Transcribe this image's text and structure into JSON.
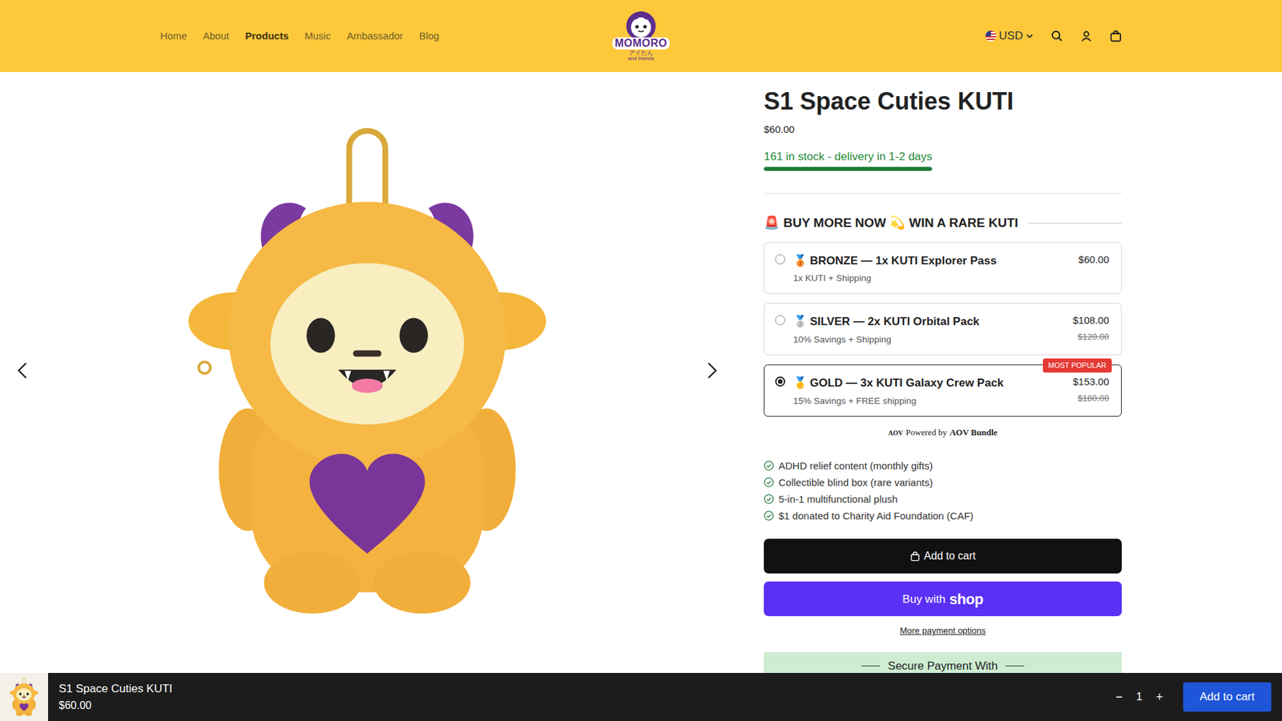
{
  "header": {
    "nav": [
      {
        "label": "Home",
        "selected": false
      },
      {
        "label": "About",
        "selected": false
      },
      {
        "label": "Products",
        "selected": true
      },
      {
        "label": "Music",
        "selected": false
      },
      {
        "label": "Ambassador",
        "selected": false
      },
      {
        "label": "Blog",
        "selected": false
      }
    ],
    "logo": {
      "name": "MOMORO",
      "sub": "アイたん",
      "tagline": "and friends"
    },
    "currency": "USD"
  },
  "product": {
    "title": "S1 Space Cuties KUTI",
    "price": "$60.00",
    "stock": {
      "text": "161 in stock - delivery in 1-2 days",
      "level": 1
    }
  },
  "bundle": {
    "heading": "🚨 BUY MORE NOW 💫 WIN A RARE KUTI",
    "options": [
      {
        "medal": "🥉",
        "title": "BRONZE — 1x KUTI Explorer Pass",
        "subtitle": "1x KUTI + Shipping",
        "price": "$60.00",
        "selected": false
      },
      {
        "medal": "🥈",
        "title": "SILVER — 2x KUTI Orbital Pack",
        "subtitle": "10% Savings + Shipping",
        "price": "$108.00",
        "compare": "$120.00",
        "selected": false
      },
      {
        "medal": "🥇",
        "title": "GOLD — 3x KUTI Galaxy Crew Pack",
        "subtitle": "15% Savings + FREE shipping",
        "price": "$153.00",
        "compare": "$180.00",
        "badge": "MOST POPULAR",
        "selected": true
      }
    ],
    "powered": {
      "mark": "AOV",
      "text": "Powered by",
      "brand": "AOV Bundle"
    }
  },
  "features": [
    "ADHD relief content (monthly gifts)",
    "Collectible blind box (rare variants)",
    "5-in-1 multifunctional plush",
    "$1 donated to Charity Aid Foundation (CAF)"
  ],
  "buttons": {
    "add_to_cart": "Add to cart",
    "buy_with": "Buy with",
    "shop": "shop",
    "more_payment": "More payment options",
    "secure": "Secure Payment With"
  },
  "sticky_bar": {
    "title": "S1 Space Cuties KUTI",
    "price": "$60.00",
    "minus": "−",
    "quantity": "1",
    "plus": "+",
    "add_to_cart": "Add to cart"
  }
}
